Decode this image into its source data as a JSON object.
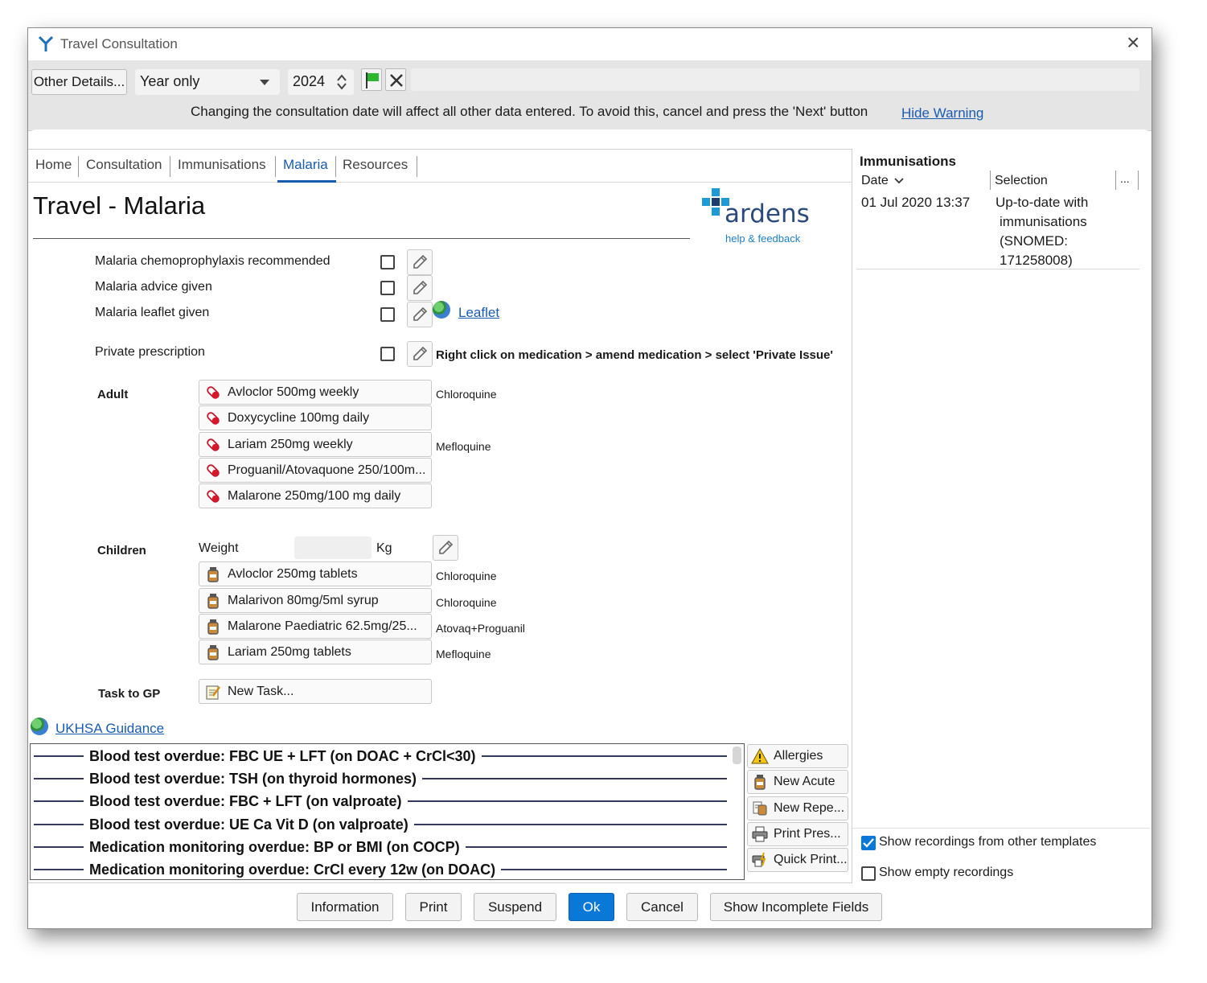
{
  "window": {
    "title": "Travel Consultation",
    "close": "×"
  },
  "toolbar": {
    "other_details": "Other Details...",
    "date_mode": "Year only",
    "year": "2024",
    "warning": "Changing the consultation date will affect all other data entered. To avoid this, cancel and press the 'Next' button",
    "hide_warning": "Hide Warning"
  },
  "tabs": [
    "Home",
    "Consultation",
    "Immunisations",
    "Malaria",
    "Resources"
  ],
  "active_tab": "Malaria",
  "page": {
    "title": "Travel - Malaria",
    "logo_text": "ardens",
    "logo_link": "help & feedback"
  },
  "checks": {
    "chemoprophylaxis": "Malaria chemoprophylaxis recommended",
    "advice": "Malaria advice given",
    "leaflet": "Malaria leaflet given",
    "leaflet_link": "Leaflet",
    "private": "Private prescription",
    "private_note": "Right click on medication > amend medication > select 'Private Issue'"
  },
  "adult": {
    "label": "Adult",
    "meds": [
      {
        "name": "Avloclor 500mg weekly",
        "note": "Chloroquine"
      },
      {
        "name": "Doxycycline 100mg daily",
        "note": ""
      },
      {
        "name": "Lariam 250mg weekly",
        "note": "Mefloquine"
      },
      {
        "name": "Proguanil/Atovaquone 250/100m...",
        "note": ""
      },
      {
        "name": "Malarone 250mg/100 mg daily",
        "note": ""
      }
    ]
  },
  "children": {
    "label": "Children",
    "weight_label": "Weight",
    "weight_unit": "Kg",
    "meds": [
      {
        "name": "Avloclor 250mg tablets",
        "note": "Chloroquine"
      },
      {
        "name": "Malarivon 80mg/5ml syrup",
        "note": "Chloroquine"
      },
      {
        "name": "Malarone Paediatric 62.5mg/25...",
        "note": "Atovaq+Proguanil"
      },
      {
        "name": "Lariam 250mg tablets",
        "note": "Mefloquine"
      }
    ]
  },
  "task": {
    "label": "Task to GP",
    "button": "New Task..."
  },
  "guidance_link": "UKHSA Guidance",
  "alerts": [
    "Blood test overdue: FBC UE + LFT (on DOAC + CrCl<30)",
    "Blood test overdue: TSH (on thyroid hormones)",
    "Blood test overdue: FBC + LFT (on valproate)",
    "Blood test overdue: UE Ca Vit D (on valproate)",
    "Medication monitoring overdue: BP or BMI (on COCP)",
    "Medication monitoring overdue: CrCl every 12w (on DOAC)"
  ],
  "side_buttons": [
    "Allergies",
    "New Acute",
    "New Repe...",
    "Print Pres...",
    "Quick Print..."
  ],
  "immunisations": {
    "title": "Immunisations",
    "col_date": "Date",
    "col_selection": "Selection",
    "col_more": "...",
    "row": {
      "date": "01 Jul 2020 13:37",
      "selection": [
        "Up-to-date with",
        "immunisations",
        "(SNOMED:",
        "171258008)"
      ]
    }
  },
  "options": {
    "show_other": "Show recordings from other templates",
    "show_other_checked": true,
    "show_empty": "Show empty recordings",
    "show_empty_checked": false
  },
  "footer": {
    "information": "Information",
    "print": "Print",
    "suspend": "Suspend",
    "ok": "Ok",
    "cancel": "Cancel",
    "incomplete": "Show Incomplete Fields"
  },
  "colors": {
    "accent": "#0a78d7",
    "link": "#1a5bb0",
    "alert_line": "#34385c",
    "tab_active": "#1a5bb0"
  }
}
